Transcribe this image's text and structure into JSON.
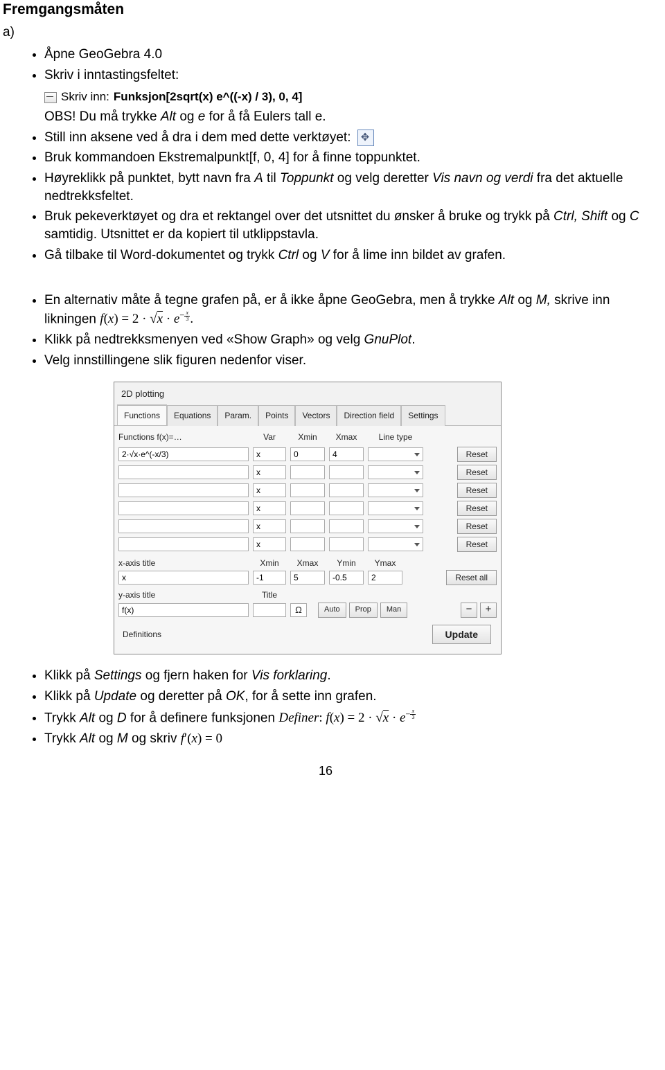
{
  "title": "Fremgangsmåten",
  "sub_a": "a)",
  "list1": {
    "i0": "Åpne GeoGebra 4.0",
    "i1": "Skriv i inntastingsfeltet:"
  },
  "skrivinn": {
    "label": "Skriv inn:",
    "command": "Funksjon[2sqrt(x) e^((-x) / 3), 0, 4]"
  },
  "obs_line_pre": "OBS! Du må trykke ",
  "obs_line_mid1": "Alt",
  "obs_line_mid2": " og ",
  "obs_line_mid3": "e",
  "obs_line_post": " for å få Eulers tall e.",
  "list2": {
    "i0": "Still inn aksene ved å dra i dem med dette verktøyet: ",
    "i1": "Bruk kommandoen Ekstremalpunkt[f, 0, 4] for å finne toppunktet.",
    "i2_a": "Høyreklikk på punktet, bytt navn fra ",
    "i2_b": "A",
    "i2_c": " til ",
    "i2_d": "Toppunkt",
    "i2_e": " og velg deretter ",
    "i2_f": "Vis navn og verdi",
    "i2_g": " fra det aktuelle nedtrekksfeltet.",
    "i3_a": "Bruk pekeverktøyet og dra et rektangel over det utsnittet du ønsker å bruke og trykk på ",
    "i3_b": "Ctrl, Shift",
    "i3_c": " og ",
    "i3_d": "C",
    "i3_e": " samtidig. Utsnittet er da kopiert til utklippstavla.",
    "i4_a": "Gå tilbake til Word-dokumentet og trykk ",
    "i4_b": "Ctrl",
    "i4_c": " og ",
    "i4_d": "V",
    "i4_e": " for å lime inn bildet av grafen."
  },
  "list3": {
    "i0_a": "En alternativ måte å tegne grafen på, er å ikke åpne GeoGebra, men å trykke ",
    "i0_b": "Alt",
    "i0_c": " og ",
    "i0_d": "M,",
    "i0_e": " skrive inn likningen  ",
    "i1_a": "Klikk på nedtrekksmenyen ved «Show Graph» og velg ",
    "i1_b": "GnuPlot",
    "i1_c": ".",
    "i2": "Velg innstillingene slik figuren nedenfor viser."
  },
  "dialog": {
    "title": "2D plotting",
    "tabs": [
      "Functions",
      "Equations",
      "Param.",
      "Points",
      "Vectors",
      "Direction field",
      "Settings"
    ],
    "header": {
      "fn": "Functions  f(x)=…",
      "var": "Var",
      "xmin": "Xmin",
      "xmax": "Xmax",
      "lt": "Line type"
    },
    "rows": [
      {
        "fn": "2·√x·e^(-x/3)",
        "var": "x",
        "xmin": "0",
        "xmax": "4",
        "reset": "Reset"
      },
      {
        "fn": "",
        "var": "x",
        "xmin": "",
        "xmax": "",
        "reset": "Reset"
      },
      {
        "fn": "",
        "var": "x",
        "xmin": "",
        "xmax": "",
        "reset": "Reset"
      },
      {
        "fn": "",
        "var": "x",
        "xmin": "",
        "xmax": "",
        "reset": "Reset"
      },
      {
        "fn": "",
        "var": "x",
        "xmin": "",
        "xmax": "",
        "reset": "Reset"
      },
      {
        "fn": "",
        "var": "x",
        "xmin": "",
        "xmax": "",
        "reset": "Reset"
      }
    ],
    "axis_header": {
      "c1": "x-axis title",
      "c2": "Xmin",
      "c3": "Xmax",
      "c4": "Ymin",
      "c5": "Ymax"
    },
    "xaxis": {
      "title": "x",
      "xmin": "-1",
      "xmax": "5",
      "ymin": "-0.5",
      "ymax": "2"
    },
    "reset_all": "Reset all",
    "yaxis_header": {
      "c1": "y-axis title",
      "c2": "Title"
    },
    "yaxis": {
      "title": "f(x)",
      "t": ""
    },
    "auto": "Auto",
    "prop": "Prop",
    "man": "Man",
    "minus": "−",
    "plus": "+",
    "definitions": "Definitions",
    "update": "Update",
    "omega": "Ω"
  },
  "list4": {
    "i0_a": "Klikk på ",
    "i0_b": "Settings",
    "i0_c": " og fjern haken for ",
    "i0_d": "Vis forklaring",
    "i0_e": ".",
    "i1_a": "Klikk på ",
    "i1_b": "Update",
    "i1_c": " og deretter på ",
    "i1_d": "OK",
    "i1_e": ", for å sette inn grafen.",
    "i2_a": "Trykk ",
    "i2_b": "Alt",
    "i2_c": " og ",
    "i2_d": "D",
    "i2_e": " for å definere funksjonen ",
    "i3_a": "Trykk ",
    "i3_b": "Alt",
    "i3_c": " og ",
    "i3_d": "M",
    "i3_e": " og skriv "
  },
  "page_number": "16"
}
